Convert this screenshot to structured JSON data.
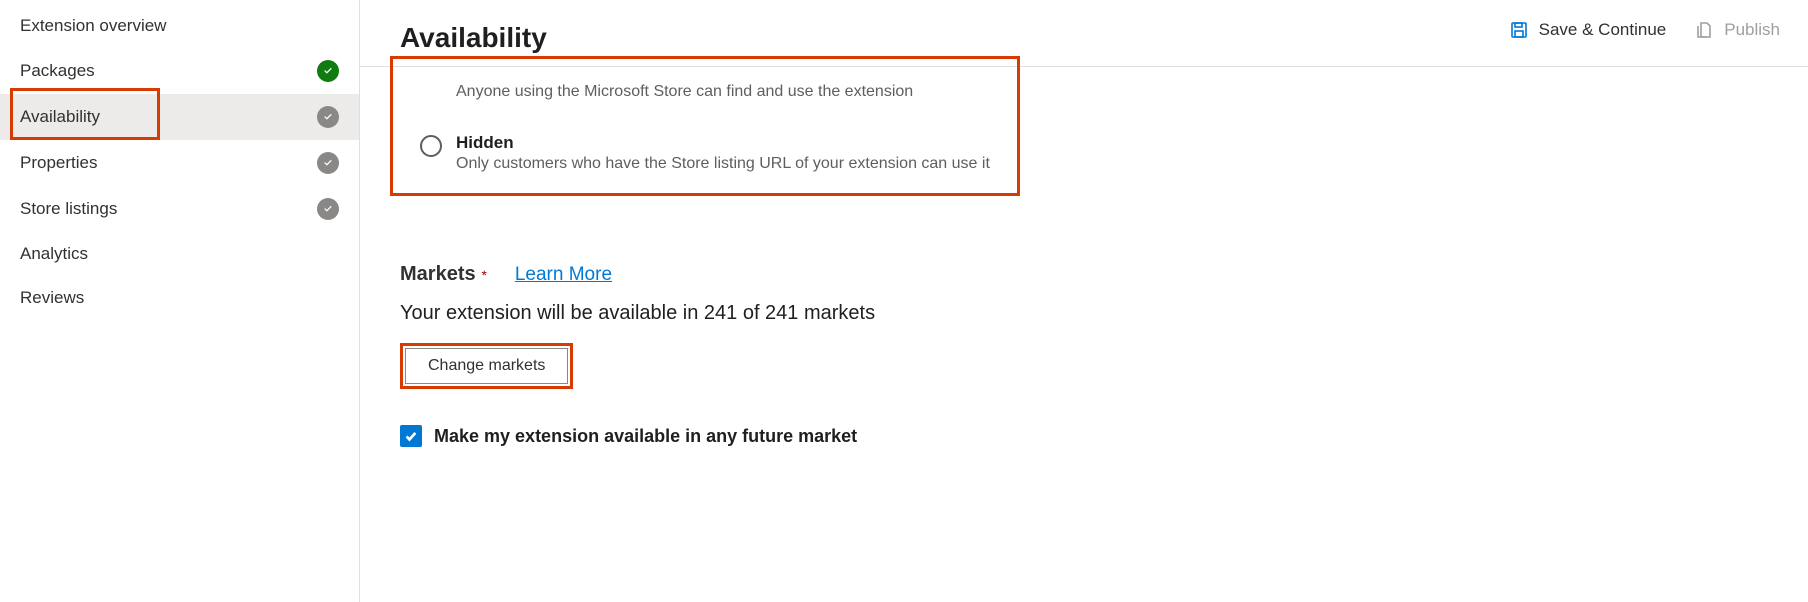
{
  "sidebar": {
    "items": [
      {
        "label": "Extension overview",
        "status": "none"
      },
      {
        "label": "Packages",
        "status": "green"
      },
      {
        "label": "Availability",
        "status": "grey"
      },
      {
        "label": "Properties",
        "status": "grey"
      },
      {
        "label": "Store listings",
        "status": "grey"
      },
      {
        "label": "Analytics",
        "status": "none"
      },
      {
        "label": "Reviews",
        "status": "none"
      }
    ]
  },
  "header": {
    "save_label": "Save & Continue",
    "publish_label": "Publish"
  },
  "page": {
    "title": "Availability"
  },
  "visibility": {
    "public_desc": "Anyone using the Microsoft Store can find and use the extension",
    "hidden_title": "Hidden",
    "hidden_desc": "Only customers who have the Store listing URL of your extension can use it"
  },
  "markets": {
    "heading": "Markets",
    "required_mark": "*",
    "learn_more": "Learn More",
    "count_text": "Your extension will be available in 241 of 241 markets",
    "change_button": "Change markets",
    "future_checkbox_label": "Make my extension available in any future market"
  }
}
